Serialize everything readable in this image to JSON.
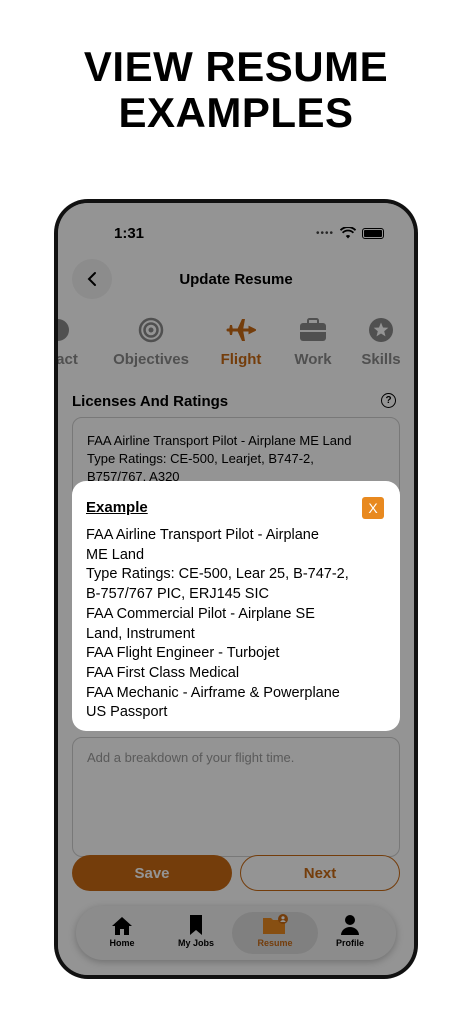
{
  "headline": [
    "VIEW RESUME",
    "EXAMPLES"
  ],
  "status_bar": {
    "time": "1:31"
  },
  "nav": {
    "title": "Update Resume"
  },
  "steps": [
    {
      "label": "act",
      "icon": "contact-icon"
    },
    {
      "label": "Objectives",
      "icon": "target-icon"
    },
    {
      "label": "Flight",
      "icon": "airplane-icon",
      "active": true
    },
    {
      "label": "Work",
      "icon": "briefcase-icon"
    },
    {
      "label": "Skills",
      "icon": "star-icon"
    }
  ],
  "section": {
    "title": "Licenses And Ratings"
  },
  "licenses_field": {
    "value_lines": [
      "FAA Airline Transport Pilot - Airplane ME Land",
      "Type Ratings: CE-500, Learjet, B747-2,",
      "B757/767, A320"
    ]
  },
  "flight_time_field": {
    "placeholder": "Add a breakdown of your flight time."
  },
  "buttons": {
    "save": "Save",
    "next": "Next"
  },
  "tabbar": [
    {
      "label": "Home",
      "icon": "home-icon"
    },
    {
      "label": "My Jobs",
      "icon": "bookmark-icon"
    },
    {
      "label": "Resume",
      "icon": "resume-folder-icon",
      "active": true
    },
    {
      "label": "Profile",
      "icon": "profile-icon"
    }
  ],
  "modal": {
    "title": "Example",
    "close_label": "X",
    "lines": [
      "FAA Airline Transport Pilot - Airplane",
      "ME Land",
      "Type Ratings: CE-500, Lear 25, B-747-2,",
      "B-757/767 PIC, ERJ145 SIC",
      "FAA Commercial Pilot - Airplane SE",
      "Land, Instrument",
      "FAA Flight Engineer - Turbojet",
      "FAA First Class Medical",
      "FAA Mechanic - Airframe & Powerplane",
      "US Passport"
    ]
  },
  "colors": {
    "accent": "#c96a14",
    "close_button": "#e8891f",
    "overlay": "rgba(0,0,0,0.42)"
  }
}
